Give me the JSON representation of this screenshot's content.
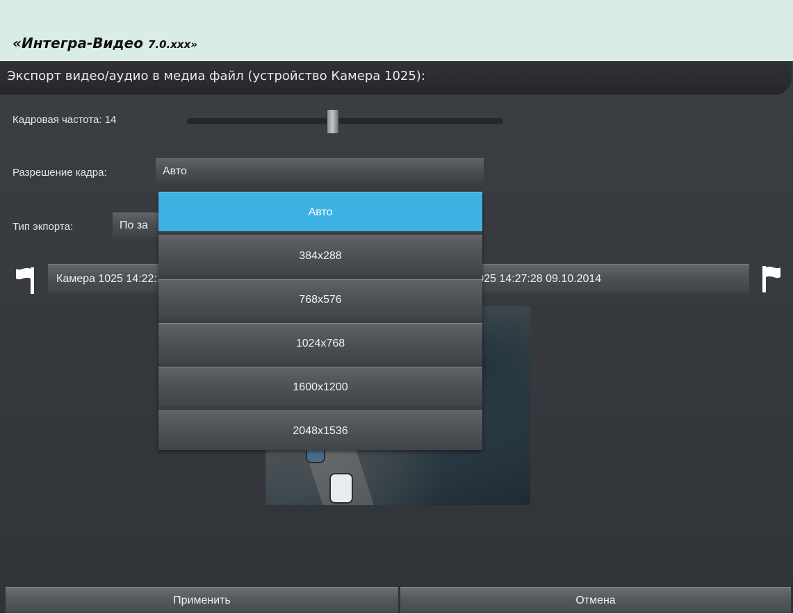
{
  "app": {
    "title": "«Интегра-Видео ",
    "version": "7.0.xxx»"
  },
  "dialog": {
    "title": "Экспорт видео/аудио в медиа файл (устройство Камера 1025):",
    "frame_rate": {
      "label": "Кадровая частота:",
      "value": "14",
      "slider_level": 0.46
    },
    "resolution": {
      "label": "Разрешение кадра:",
      "value": "Авто",
      "options": [
        "Авто",
        "384x288",
        "768x576",
        "1024x768",
        "1600x1200",
        "2048x1536"
      ],
      "selected_index": 0
    },
    "export_type": {
      "label": "Тип экпорта:",
      "value": "По за"
    },
    "range": {
      "start": "Камера 1025 14:22:12 09.10.2014",
      "end": "Камера 1025 14:27:28 09.10.2014",
      "start_flag_icon": "flag-left-icon",
      "end_flag_icon": "flag-right-icon"
    },
    "buttons": {
      "apply": "Применить",
      "cancel": "Отмена"
    }
  },
  "colors": {
    "header_bg": "#d9ece6",
    "dialog_bg": "#3b3e42",
    "selected_item": "#3fb2e4"
  }
}
